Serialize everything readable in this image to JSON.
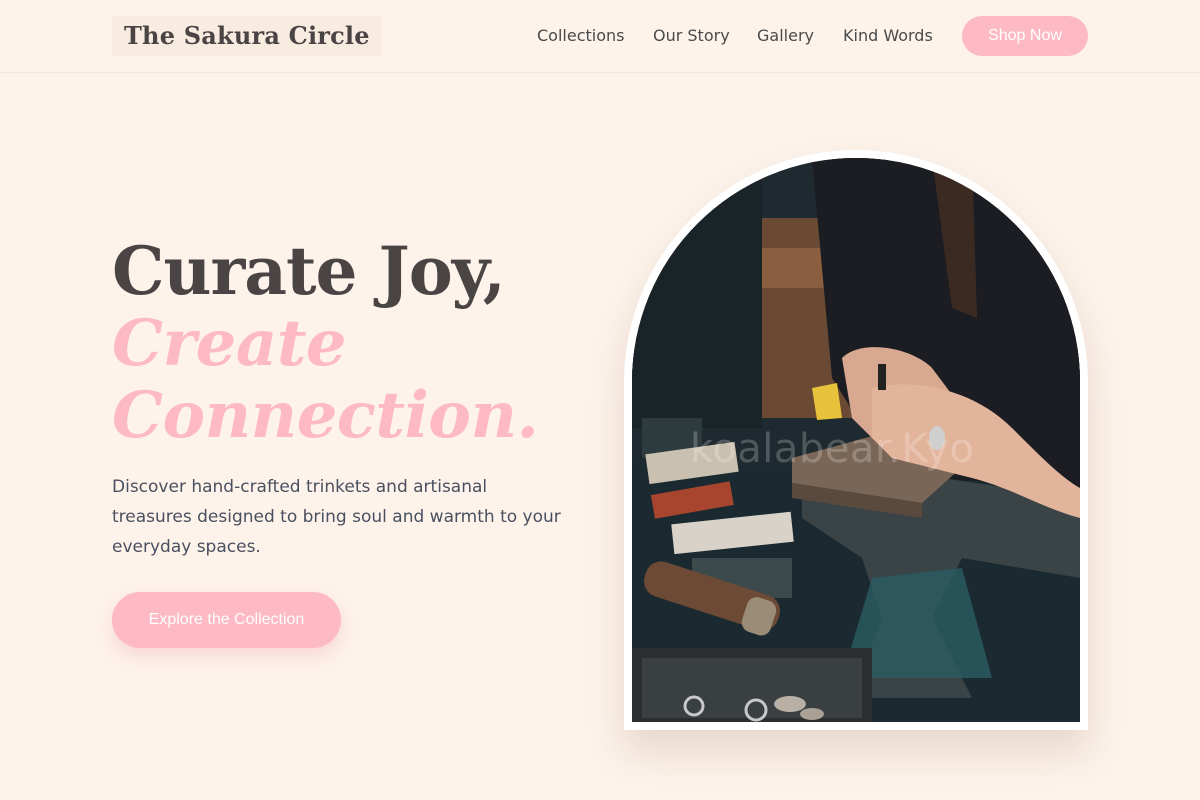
{
  "header": {
    "brand": "The Sakura Circle",
    "nav": [
      "Collections",
      "Our Story",
      "Gallery",
      "Kind Words"
    ],
    "shop_label": "Shop Now"
  },
  "hero": {
    "line1": "Curate Joy,",
    "line2": "Create",
    "line3": "Connection.",
    "description": "Discover hand-crafted trinkets and artisanal treasures designed to bring soul and warmth to your everyday spaces.",
    "cta_label": "Explore the Collection"
  },
  "image": {
    "watermark": "koalabear.Kyo",
    "subject": "artisan hands stamping a ring on a metal anvil"
  },
  "colors": {
    "background": "#fdf3ea",
    "accent_pink": "#fdb9c4",
    "text_dark": "#4a4444"
  }
}
